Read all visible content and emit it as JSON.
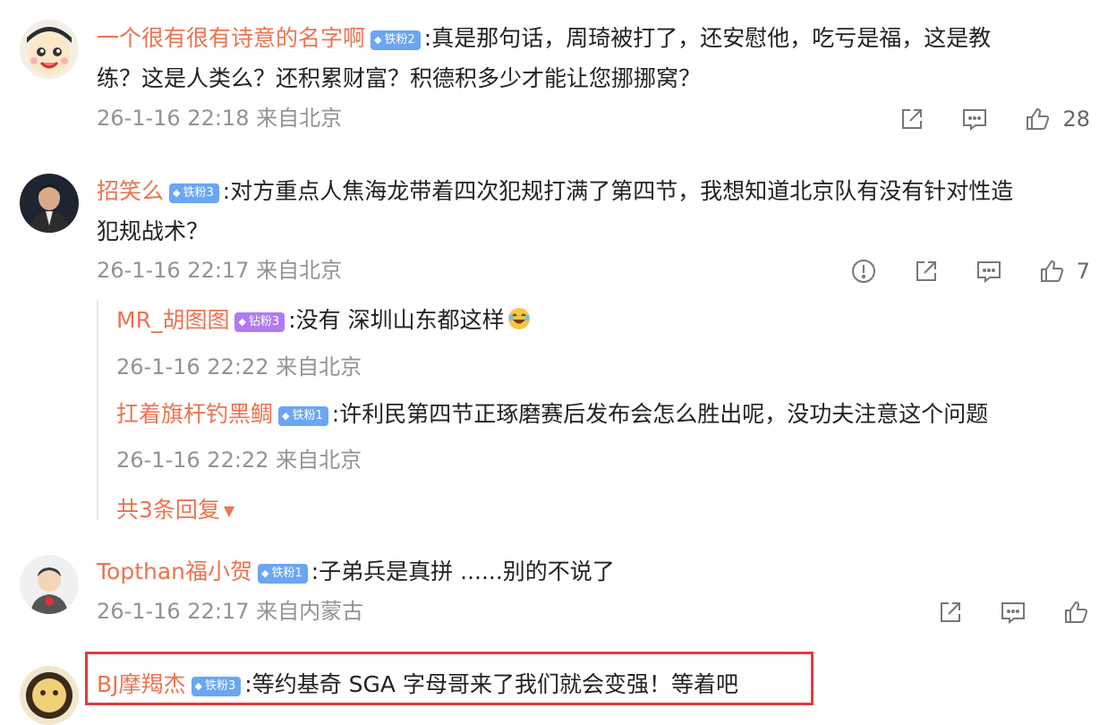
{
  "comments": [
    {
      "username": "一个很有很有诗意的名字啊",
      "badge": "铁粉2",
      "text_line1": ":真是那句话，周琦被打了，还安慰他，吃亏是福，这是教",
      "text_line2": "练？这是人类么？还积累财富？积德积多少才能让您挪挪窝？",
      "meta": "26-1-16 22:18 来自北京",
      "likes": "28"
    },
    {
      "username": "招笑么",
      "badge": "铁粉3",
      "text_line1": ":对方重点人焦海龙带着四次犯规打满了第四节，我想知道北京队有没有针对性造",
      "text_line2": "犯规战术？",
      "meta": "26-1-16 22:17 来自北京",
      "likes": "7",
      "replies": [
        {
          "username": "MR_胡图图",
          "badge": "钻粉3",
          "text": ":没有 深圳山东都这样",
          "meta": "26-1-16 22:22 来自北京"
        },
        {
          "username": "扛着旗杆钓黑鲷",
          "badge": "铁粉1",
          "text": ":许利民第四节正琢磨赛后发布会怎么胜出呢，没功夫注意这个问题",
          "meta": "26-1-16 22:22 来自北京"
        }
      ],
      "more_replies": "共3条回复"
    },
    {
      "username": "Topthan福小贺",
      "badge": "铁粉1",
      "text_line1": ":子弟兵是真拼 ......别的不说了",
      "meta": "26-1-16 22:17 来自内蒙古"
    },
    {
      "username": "BJ摩羯杰",
      "badge": "铁粉3",
      "text_line1": ":等约基奇 SGA 字母哥来了我们就会变强！等着吧"
    }
  ],
  "icons": {
    "share": "share-icon",
    "comment": "comment-icon",
    "like": "thumbs-up-icon",
    "report": "report-icon",
    "laugh_emoji": "laughing-emoji-icon",
    "more_arrow": "caret-down-icon"
  },
  "colors": {
    "username": "#eb7350",
    "meta": "#939393",
    "badge_blue": "#6aa6f5",
    "badge_purple": "#b07bf0",
    "highlight_border": "#e23a3a"
  }
}
